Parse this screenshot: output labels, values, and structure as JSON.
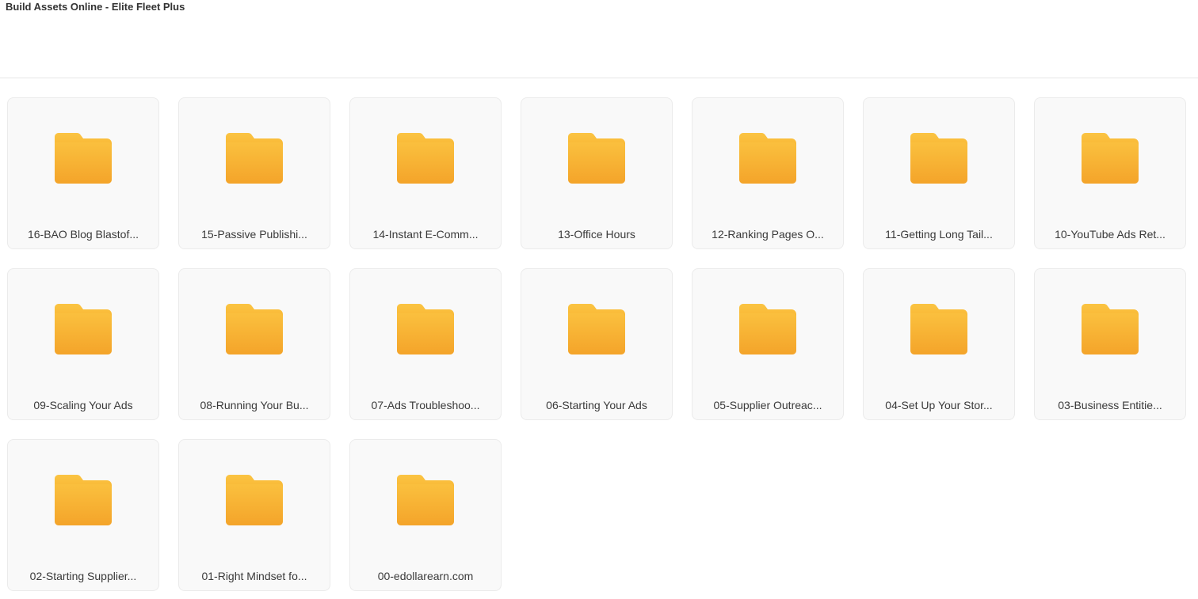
{
  "header": {
    "title": "Build Assets Online - Elite Fleet Plus"
  },
  "colors": {
    "folder_top": "#FAC03E",
    "folder_bottom": "#F4A42A",
    "card_bg": "#F9F9F9",
    "card_border": "#EBEBEB"
  },
  "folders": [
    {
      "label": "16-BAO Blog Blastof...",
      "icon": "folder-icon"
    },
    {
      "label": "15-Passive Publishi...",
      "icon": "folder-icon"
    },
    {
      "label": "14-Instant E-Comm...",
      "icon": "folder-icon"
    },
    {
      "label": "13-Office Hours",
      "icon": "folder-icon"
    },
    {
      "label": "12-Ranking Pages O...",
      "icon": "folder-icon"
    },
    {
      "label": "11-Getting Long Tail...",
      "icon": "folder-icon"
    },
    {
      "label": "10-YouTube Ads Ret...",
      "icon": "folder-icon"
    },
    {
      "label": "09-Scaling Your Ads",
      "icon": "folder-icon"
    },
    {
      "label": "08-Running Your Bu...",
      "icon": "folder-icon"
    },
    {
      "label": "07-Ads Troubleshoo...",
      "icon": "folder-icon"
    },
    {
      "label": "06-Starting Your Ads",
      "icon": "folder-icon"
    },
    {
      "label": "05-Supplier Outreac...",
      "icon": "folder-icon"
    },
    {
      "label": "04-Set Up Your Stor...",
      "icon": "folder-icon"
    },
    {
      "label": "03-Business Entitie...",
      "icon": "folder-icon"
    },
    {
      "label": "02-Starting Supplier...",
      "icon": "folder-icon"
    },
    {
      "label": "01-Right Mindset fo...",
      "icon": "folder-icon"
    },
    {
      "label": "00-edollarearn.com",
      "icon": "folder-icon"
    }
  ]
}
